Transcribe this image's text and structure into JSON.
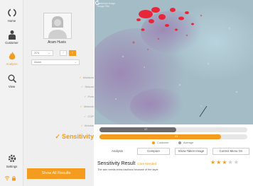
{
  "nav": {
    "home": "Home",
    "customer": "Customer",
    "analysis": "Analysis",
    "view": "View",
    "settings": "Settings"
  },
  "profile": {
    "name": "Aram Huvis",
    "age_value": "20's",
    "ethnicity_value": "Asian",
    "gender_selected": "female"
  },
  "metrics": [
    "Moisture",
    "Sebum",
    "Pore",
    "Melanin",
    "COP",
    "Wrinkle"
  ],
  "active_metric": "Sensitivity",
  "show_all_label": "Show All Results",
  "image": {
    "label_line1": "Polarized Image",
    "label_line2": "Image Title"
  },
  "bars": {
    "customer_value": "17",
    "customer_fraction": 0.17,
    "average_value": "23",
    "average_fraction": 0.23,
    "customer_label": "Customer",
    "average_label": "Average"
  },
  "tabs": {
    "analysis": "Analysis",
    "compare": "Compare",
    "show_taken": "Show Taken Image",
    "control_menu": "Control Menu On"
  },
  "result": {
    "title": "Sensitivity Result",
    "status": "Care Needed",
    "description": "The skin needs extra cautious because of the layer.",
    "rating": 3,
    "rating_max": 5
  },
  "colors": {
    "accent": "#f39c1f",
    "customer_bar": "#6b6b6b",
    "average_bar": "#f39c1f"
  }
}
